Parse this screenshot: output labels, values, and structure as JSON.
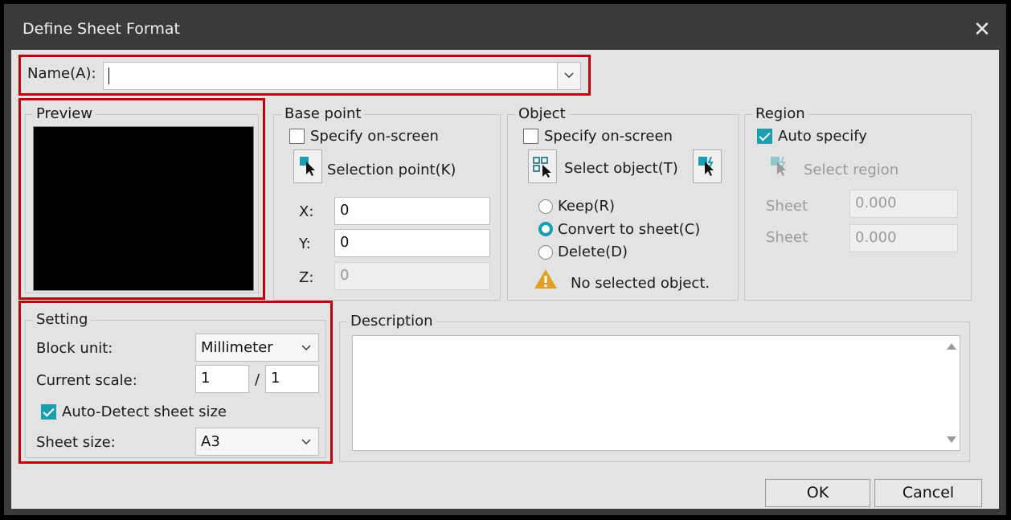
{
  "window": {
    "title": "Define Sheet Format",
    "close_glyph": "✕"
  },
  "name": {
    "label": "Name(A):",
    "value": ""
  },
  "preview": {
    "label": "Preview"
  },
  "base_point": {
    "label": "Base point",
    "specify": "Specify on-screen",
    "selection_point": "Selection point(K)",
    "x_label": "X:",
    "x_value": "0",
    "y_label": "Y:",
    "y_value": "0",
    "z_label": "Z:",
    "z_value": "0"
  },
  "object": {
    "label": "Object",
    "specify": "Specify on-screen",
    "select_object": "Select object(T)",
    "keep": "Keep(R)",
    "convert": "Convert to sheet(C)",
    "delete": "Delete(D)",
    "status": "No selected object.",
    "selected_option": "convert"
  },
  "region": {
    "label": "Region",
    "auto_specify": "Auto specify",
    "auto_specify_checked": true,
    "select_region": "Select region",
    "sheet1_label": "Sheet",
    "sheet1_value": "0.000",
    "sheet2_label": "Sheet",
    "sheet2_value": "0.000"
  },
  "setting": {
    "label": "Setting",
    "block_unit_label": "Block unit:",
    "block_unit_value": "Millimeter",
    "current_scale_label": "Current scale:",
    "scale_num": "1",
    "scale_sep": "/",
    "scale_den": "1",
    "auto_detect": "Auto-Detect sheet size",
    "auto_detect_checked": true,
    "sheet_size_label": "Sheet size:",
    "sheet_size_value": "A3"
  },
  "description": {
    "label": "Description",
    "value": ""
  },
  "buttons": {
    "ok": "OK",
    "cancel": "Cancel"
  },
  "colors": {
    "accent": "#1a9eb0",
    "highlight_border": "#c0000c",
    "warning": "#e0a020"
  }
}
